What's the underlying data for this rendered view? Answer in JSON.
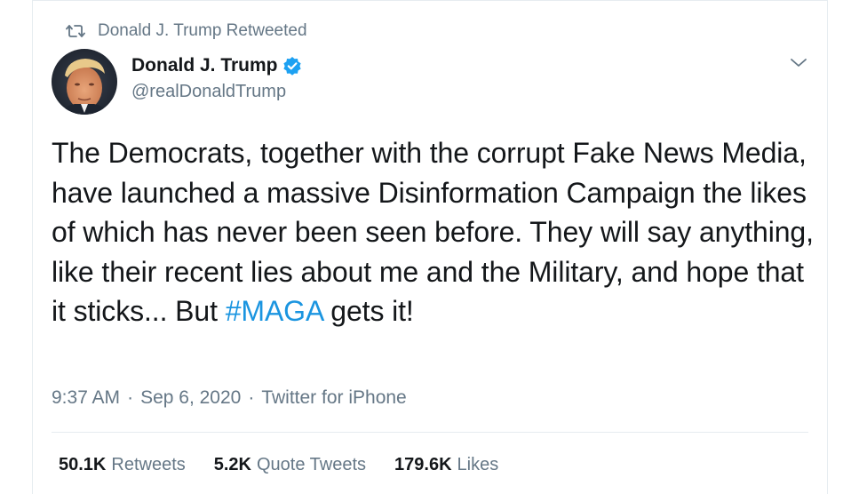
{
  "retweet_banner": {
    "icon": "retweet-icon",
    "text": "Donald J. Trump Retweeted"
  },
  "author": {
    "display_name": "Donald J. Trump",
    "handle": "@realDonaldTrump",
    "verified": true,
    "avatar_icon": "avatar-photo"
  },
  "tweet": {
    "text_before_hashtag": "The Democrats, together with the corrupt Fake News Media, have launched a massive Disinformation Campaign the likes of which has never been seen before. They will say anything, like their recent lies about me and the Military, and hope that it sticks... But ",
    "hashtag": "#MAGA",
    "text_after_hashtag": " gets it!"
  },
  "meta": {
    "time": "9:37 AM",
    "separator": "·",
    "date": "Sep 6, 2020",
    "source": "Twitter for iPhone"
  },
  "stats": {
    "retweets_count": "50.1K",
    "retweets_label": "Retweets",
    "quotes_count": "5.2K",
    "quotes_label": "Quote Tweets",
    "likes_count": "179.6K",
    "likes_label": "Likes"
  },
  "colors": {
    "text": "#14171a",
    "secondary": "#657786",
    "link": "#1b95e0",
    "verified": "#1da1f2",
    "border": "#e6ecf0"
  }
}
